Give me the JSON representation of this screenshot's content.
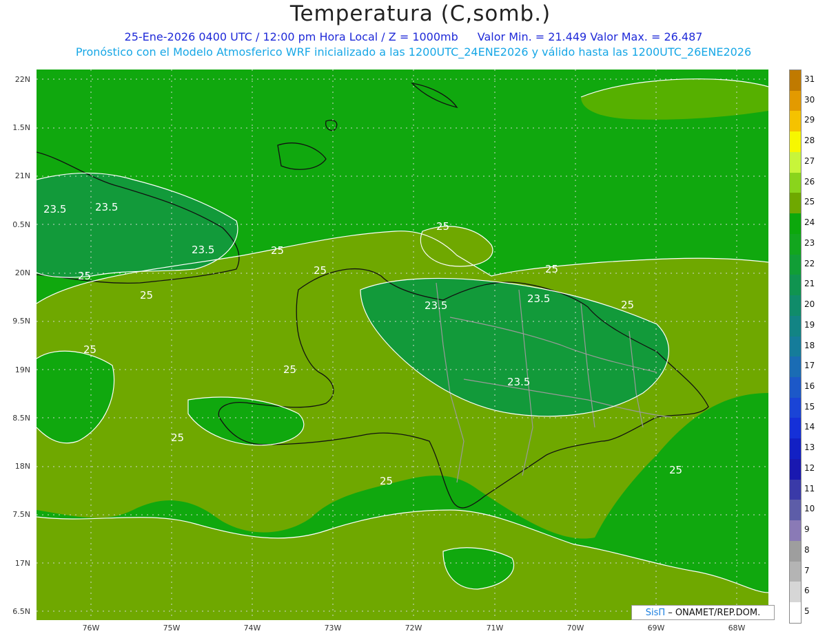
{
  "header": {
    "title": "Temperatura (C,somb.)",
    "line1": "25-Ene-2026 0400 UTC / 12:00 pm Hora Local / Z = 1000mb",
    "minmax": "Valor Min. = 21.449   Valor Max. = 26.487",
    "line2": "Pronóstico con el Modelo Atmosferico WRF inicializado a las 1200UTC_24ENE2026 y válido hasta las  1200UTC_26ENE2026"
  },
  "axes": {
    "lat_labels": [
      "22N",
      "1.5N",
      "21N",
      "0.5N",
      "20N",
      "9.5N",
      "19N",
      "8.5N",
      "18N",
      "7.5N",
      "17N",
      "6.5N"
    ],
    "lon_labels": [
      "76W",
      "75W",
      "74W",
      "73W",
      "72W",
      "71W",
      "70W",
      "69W",
      "68W"
    ]
  },
  "colorbar": {
    "labels": [
      "31",
      "30",
      "29",
      "28",
      "27",
      "26",
      "25",
      "24",
      "23",
      "22",
      "21",
      "20",
      "19",
      "18",
      "17",
      "16",
      "15",
      "14",
      "13",
      "12",
      "11",
      "10",
      "9",
      "8",
      "7",
      "6",
      "5"
    ],
    "colors": [
      "#c07a00",
      "#e39a00",
      "#f5c200",
      "#f7f700",
      "#c8f53a",
      "#8ad41c",
      "#6fa800",
      "#0ca80c",
      "#12a61e",
      "#119e36",
      "#109450",
      "#108c6a",
      "#128484",
      "#157c9a",
      "#1a6cb4",
      "#1c58c8",
      "#1a44d6",
      "#1530d8",
      "#1220c4",
      "#1918b0",
      "#3a3aa8",
      "#5d5da8",
      "#8a7ab6",
      "#9e9e9e",
      "#b4b4b4",
      "#d6d6d6",
      "#ffffff"
    ]
  },
  "contour_labels": [
    "23.5",
    "25",
    "23.5",
    "25",
    "25",
    "23.5",
    "25",
    "25",
    "25",
    "23.5",
    "25",
    "23.5",
    "23.5",
    "25",
    "25",
    "25",
    "25",
    "25"
  ],
  "credit": {
    "brand": "SisΠ",
    "text": "– ONAMET/REP.DOM."
  }
}
